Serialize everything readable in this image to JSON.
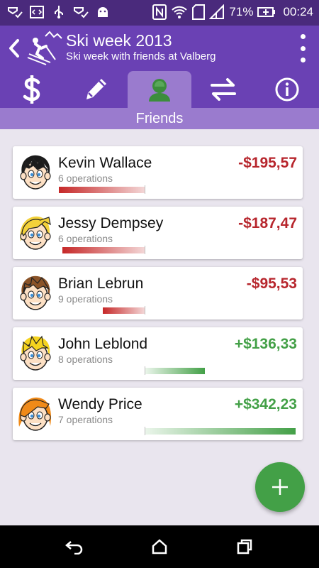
{
  "status_bar": {
    "battery_percent": "71%",
    "time": "00:24",
    "left_icons": [
      "mail-check-icon",
      "code-icon",
      "usb-icon",
      "mail-check-icon",
      "android-icon"
    ],
    "right_icons": [
      "nfc-icon",
      "wifi-icon",
      "sd-card-icon",
      "signal-icon",
      "battery-icon"
    ]
  },
  "app_bar": {
    "title": "Ski week 2013",
    "subtitle": "Ski week with friends at Valberg",
    "background": "#6a41b4"
  },
  "tabs": [
    {
      "icon": "dollar-icon",
      "active": false
    },
    {
      "icon": "pencil-icon",
      "active": false
    },
    {
      "icon": "friend-icon",
      "active": true
    },
    {
      "icon": "transfer-arrows-icon",
      "active": false
    },
    {
      "icon": "info-icon",
      "active": false
    }
  ],
  "section": {
    "label": "Friends"
  },
  "friends": [
    {
      "name": "Kevin Wallace",
      "ops": "6 operations",
      "amount": "-$195,57",
      "balance": -195.57,
      "avatar": "boy-black-hair-avatar"
    },
    {
      "name": "Jessy Dempsey",
      "ops": "6 operations",
      "amount": "-$187,47",
      "balance": -187.47,
      "avatar": "girl-blonde-hair-avatar"
    },
    {
      "name": "Brian Lebrun",
      "ops": "9 operations",
      "amount": "-$95,53",
      "balance": -95.53,
      "avatar": "boy-brown-hair-avatar"
    },
    {
      "name": "John Leblond",
      "ops": "8 operations",
      "amount": "+$136,33",
      "balance": 136.33,
      "avatar": "boy-blonde-hair-avatar"
    },
    {
      "name": "Wendy Price",
      "ops": "7 operations",
      "amount": "+$342,23",
      "balance": 342.23,
      "avatar": "girl-orange-hair-avatar"
    }
  ],
  "colors": {
    "negative": "#b7262d",
    "positive": "#43a047",
    "fab": "#43a047"
  },
  "fab": {
    "icon": "plus-icon"
  },
  "nav_bar": {
    "icons": [
      "back-icon",
      "home-icon",
      "recents-icon"
    ]
  }
}
